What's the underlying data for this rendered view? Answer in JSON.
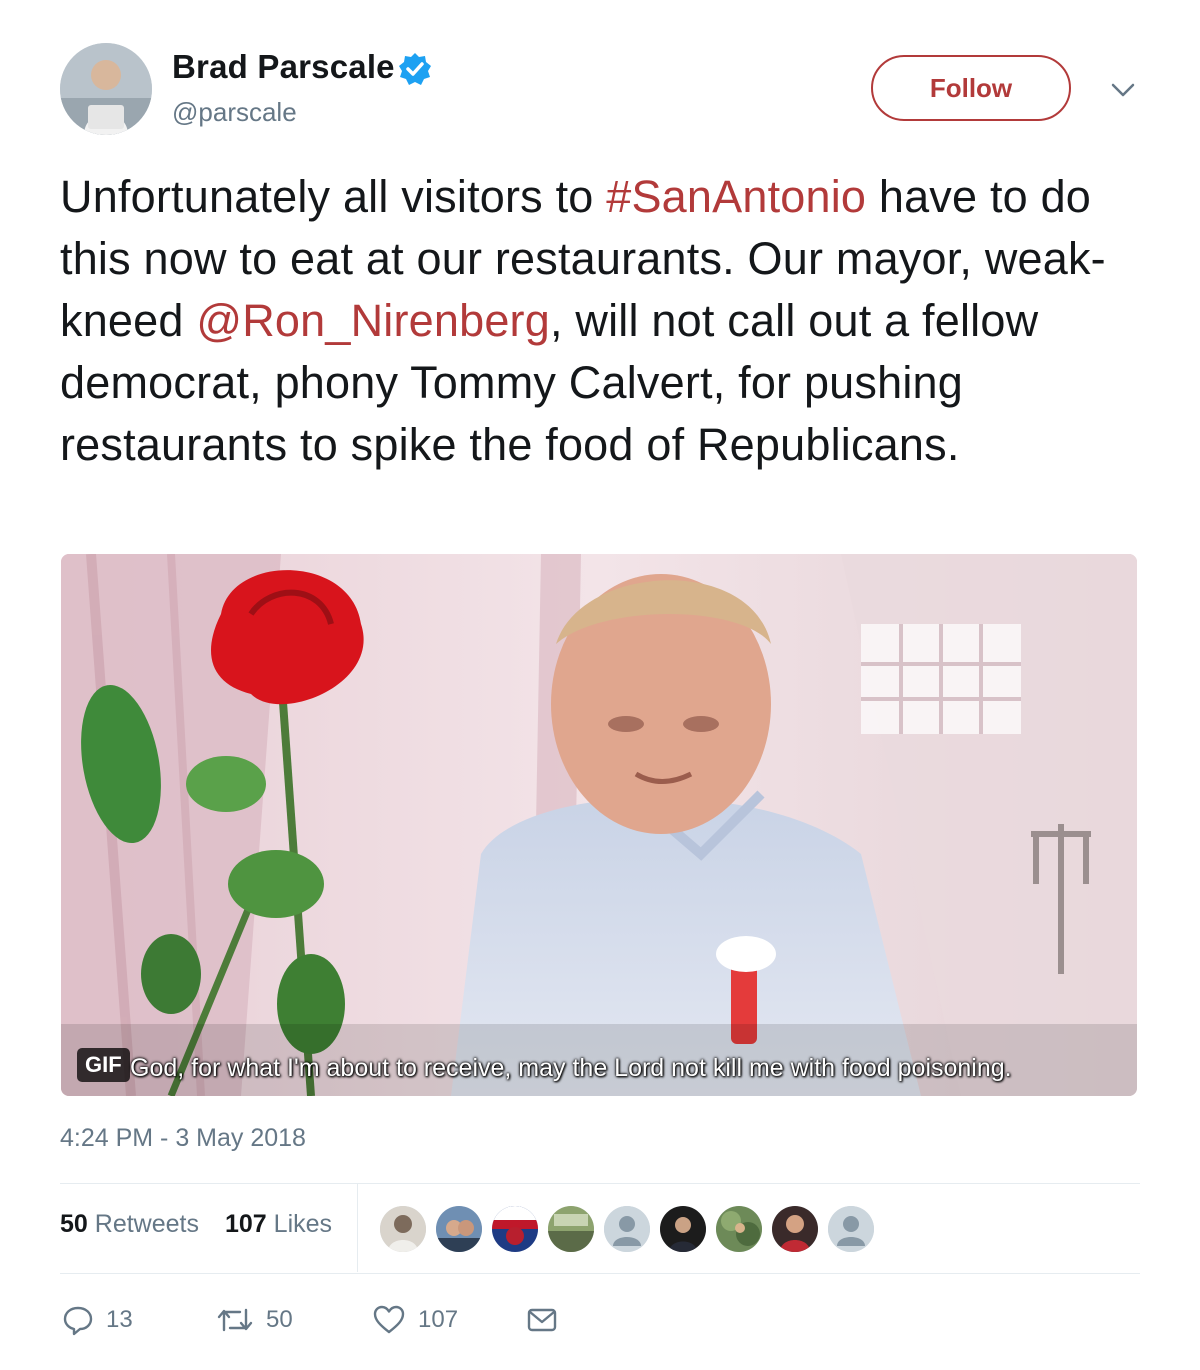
{
  "author": {
    "name": "Brad Parscale",
    "handle": "@parscale",
    "verified": true,
    "avatar_icon": "profile-photo"
  },
  "header": {
    "follow_label": "Follow",
    "menu_icon": "chevron-down-icon"
  },
  "tweet": {
    "text_parts": {
      "p1": "Unfortunately all visitors to ",
      "hashtag": "#SanAntonio",
      "p2": " have to do this now to eat at our restaurants. Our mayor, weak-kneed ",
      "mention": "@Ron_Nirenberg",
      "p3": ", will not call out a fellow democrat, phony Tommy Calvert, for pushing restaurants to spike the food of Republicans."
    },
    "media": {
      "badge": "GIF",
      "subtitle": "God, for what I'm about to receive, may the Lord not kill me with food poisoning."
    },
    "timestamp": "4:24 PM - 3 May 2018"
  },
  "stats": {
    "retweets_count": "50",
    "retweets_label": "Retweets",
    "likes_count": "107",
    "likes_label": "Likes",
    "liker_avatars": 9
  },
  "actions": {
    "reply_count": "13",
    "retweet_count": "50",
    "like_count": "107"
  },
  "colors": {
    "accent": "#b23a3a",
    "verified": "#1da1f2",
    "muted_text": "#657786"
  }
}
